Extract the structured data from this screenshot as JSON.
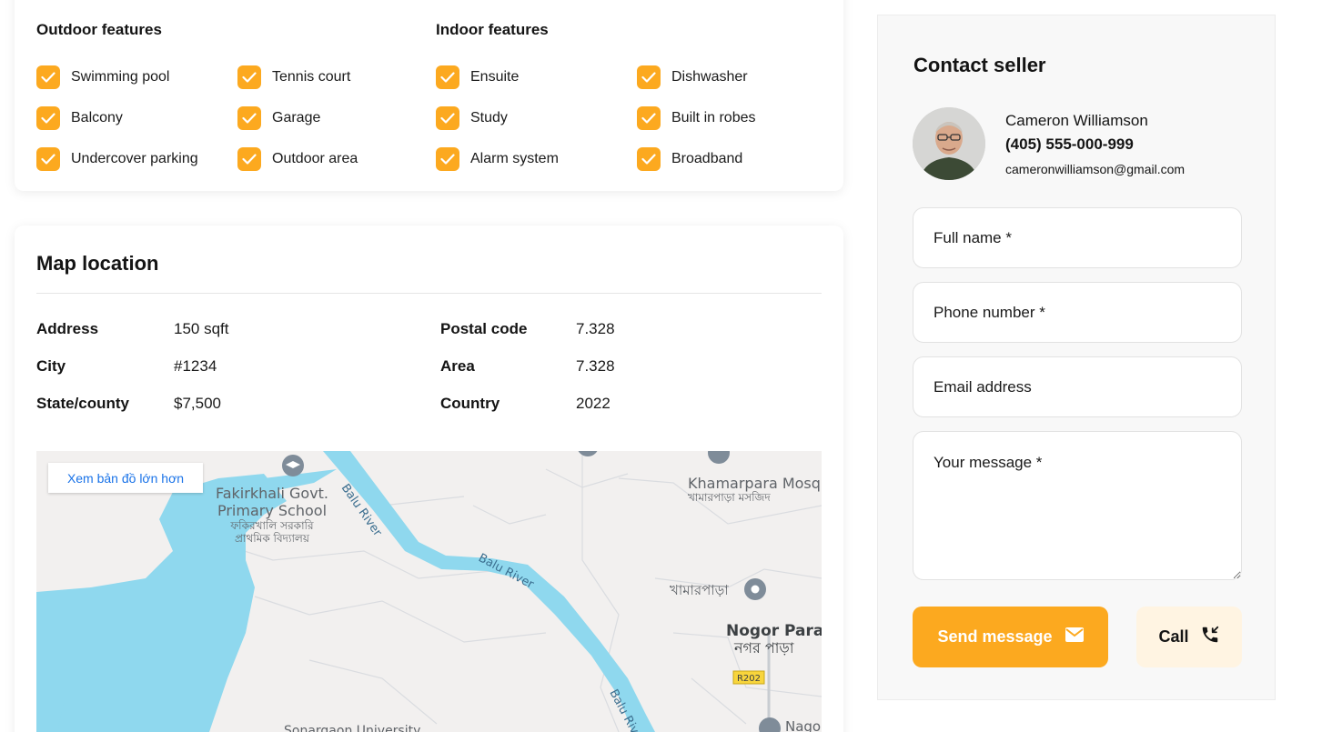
{
  "features": {
    "outdoor_title": "Outdoor features",
    "indoor_title": "Indoor features",
    "outdoor": [
      "Swimming pool",
      "Tennis court",
      "Balcony",
      "Garage",
      "Undercover parking",
      "Outdoor area"
    ],
    "indoor": [
      "Ensuite",
      "Dishwasher",
      "Study",
      "Built in robes",
      "Alarm system",
      "Broadband"
    ]
  },
  "map_location": {
    "title": "Map location",
    "left": [
      {
        "label": "Address",
        "value": "150 sqft"
      },
      {
        "label": "City",
        "value": "#1234"
      },
      {
        "label": "State/county",
        "value": "$7,500"
      }
    ],
    "right": [
      {
        "label": "Postal code",
        "value": "7.328"
      },
      {
        "label": "Area",
        "value": "7.328"
      },
      {
        "label": "Country",
        "value": "2022"
      }
    ]
  },
  "map": {
    "larger_map_link": "Xem bản đồ lớn hơn",
    "labels": {
      "school_en_1": "Fakirkhali Govt.",
      "school_en_2": "Primary School",
      "school_bn_1": "ফকিরখালি সরকারি",
      "school_bn_2": "প্রাথমিক বিদ্যালয়",
      "mosque_en": "Khamarpara Mosq",
      "mosque_bn": "খামারপাড়া মসজিদ",
      "khamarpara_bn": "খামারপাড়া",
      "nogor_en": "Nogor Para",
      "nogor_bn": "নগর পাড়া",
      "river_1": "Balu River",
      "river_2": "Balu River",
      "river_3": "Balu River",
      "road": "R202",
      "university": "Sonargaon University",
      "nago": "Nago"
    },
    "colors": {
      "water": "#8fd8ee",
      "land": "#f2f0ef",
      "road": "#dadce0"
    }
  },
  "contact": {
    "title": "Contact seller",
    "name": "Cameron Williamson",
    "phone": "(405) 555-000-999",
    "email": "cameronwilliamson@gmail.com",
    "placeholders": {
      "full_name": "Full name *",
      "phone": "Phone number *",
      "email": "Email address",
      "message": "Your message *"
    },
    "send_label": "Send message",
    "call_label": "Call"
  },
  "colors": {
    "accent": "#fca91f",
    "accent_light": "#fff4e2",
    "text": "#141414"
  },
  "icons": {
    "check": "check-icon",
    "envelope": "envelope-icon",
    "phone": "phone-incoming-icon",
    "pin": "map-pin-icon"
  }
}
